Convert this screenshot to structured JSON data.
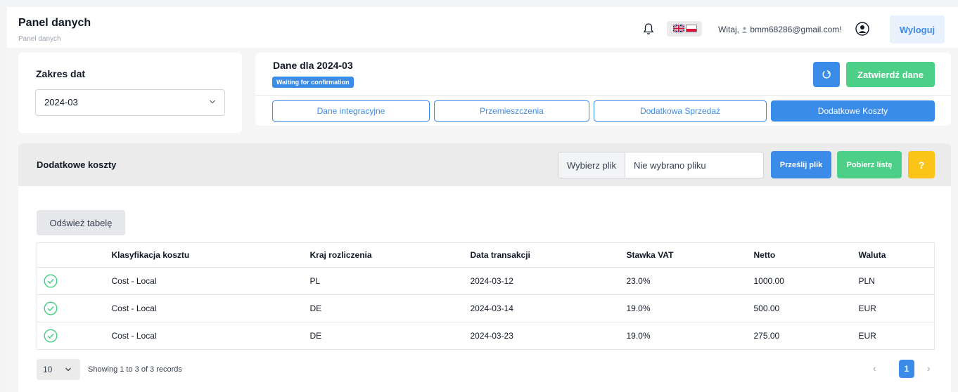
{
  "header": {
    "title": "Panel danych",
    "breadcrumb": "Panel danych",
    "greeting": "Witaj, ",
    "user_email": "bmm68286@gmail.com!",
    "logout_label": "Wyloguj",
    "icons": [
      "bell-icon",
      "flag-uk-icon",
      "flag-pl-icon",
      "person-icon",
      "user-circle-icon"
    ]
  },
  "date_range": {
    "label": "Zakres dat",
    "selected": "2024-03"
  },
  "data_panel": {
    "title": "Dane dla 2024-03",
    "status_badge": "Waiting for confirmation",
    "confirm_label": "Zatwierdź dane",
    "tabs": [
      {
        "label": "Dane integracyjne",
        "active": false
      },
      {
        "label": "Przemieszczenia",
        "active": false
      },
      {
        "label": "Dodatkowa Sprzedaż",
        "active": false
      },
      {
        "label": "Dodatkowe Koszty",
        "active": true
      }
    ]
  },
  "costs": {
    "title": "Dodatkowe koszty",
    "file_button": "Wybierz plik",
    "file_name": "Nie wybrano pliku",
    "upload_label": "Prześlij plik",
    "download_label": "Pobierz listę",
    "help_label": "?",
    "refresh_table_label": "Odśwież tabelę",
    "columns": [
      "",
      "Klasyfikacja kosztu",
      "Kraj rozliczenia",
      "Data transakcji",
      "Stawka VAT",
      "Netto",
      "Waluta"
    ],
    "rows": [
      {
        "classification": "Cost - Local",
        "country": "PL",
        "date": "2024-03-12",
        "vat": "23.0%",
        "net": "1000.00",
        "currency": "PLN"
      },
      {
        "classification": "Cost - Local",
        "country": "DE",
        "date": "2024-03-14",
        "vat": "19.0%",
        "net": "500.00",
        "currency": "EUR"
      },
      {
        "classification": "Cost - Local",
        "country": "DE",
        "date": "2024-03-23",
        "vat": "19.0%",
        "net": "275.00",
        "currency": "EUR"
      }
    ],
    "page_size": "10",
    "records_text": "Showing 1 to 3 of 3 records",
    "current_page": "1"
  },
  "colors": {
    "primary": "#3b8ce8",
    "success": "#4ccf87",
    "warning": "#fcc419"
  }
}
